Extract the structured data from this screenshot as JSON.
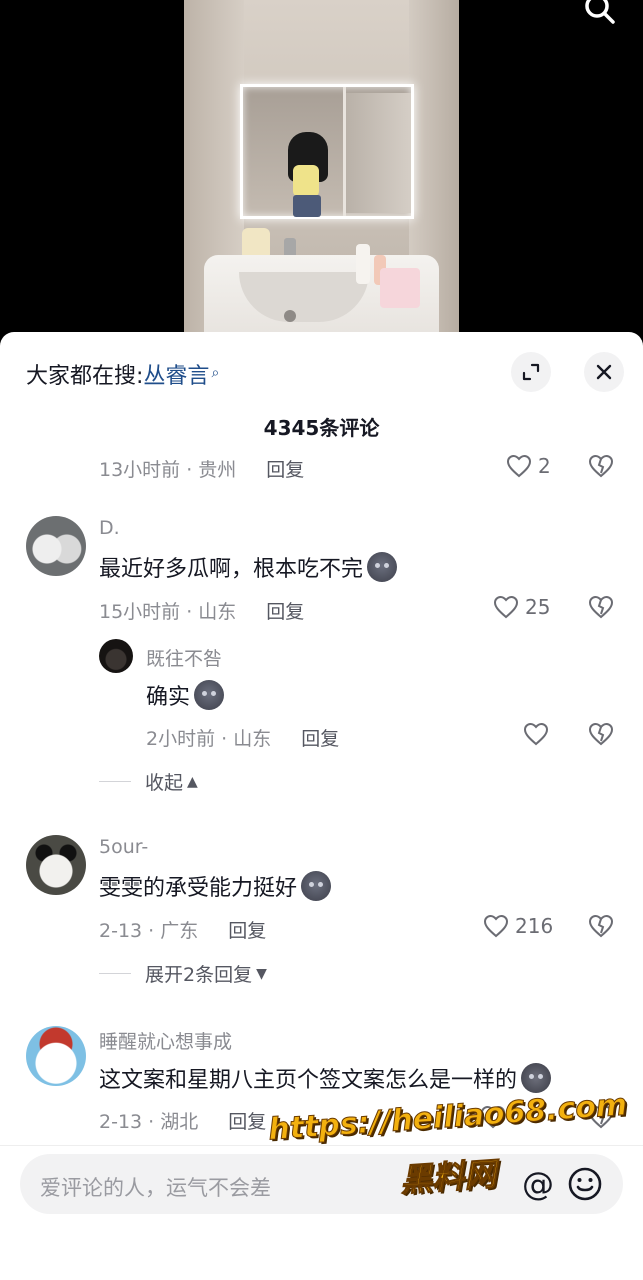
{
  "header": {
    "hot_search_prefix": "大家都在搜:",
    "hot_search_keyword": "丛睿言",
    "comment_count": "4345条评论"
  },
  "comments": [
    {
      "meta": "13小时前 · 贵州",
      "reply": "回复",
      "likes": "2"
    },
    {
      "name": "D.",
      "text": "最近好多瓜啊，根本吃不完",
      "meta": "15小时前 · 山东",
      "reply": "回复",
      "likes": "25",
      "sub": {
        "name": "既往不咎",
        "text": "确实",
        "meta": "2小时前 · 山东",
        "reply": "回复"
      },
      "fold_label": "收起"
    },
    {
      "name": "5our-",
      "text": "雯雯的承受能力挺好",
      "meta": "2-13 · 广东",
      "reply": "回复",
      "likes": "216",
      "fold_label": "展开2条回复"
    },
    {
      "name": "睡醒就心想事成",
      "text": "这文案和星期八主页个签文案怎么是一样的",
      "meta": "2-13 · 湖北",
      "reply": "回复"
    }
  ],
  "input": {
    "placeholder": "爱评论的人，运气不会差"
  },
  "watermark": {
    "url": "https://heiliao68.com",
    "name": "黑料网"
  },
  "colors": {
    "keyword": "#1f4d8a",
    "watermark": "#f3b10f"
  }
}
